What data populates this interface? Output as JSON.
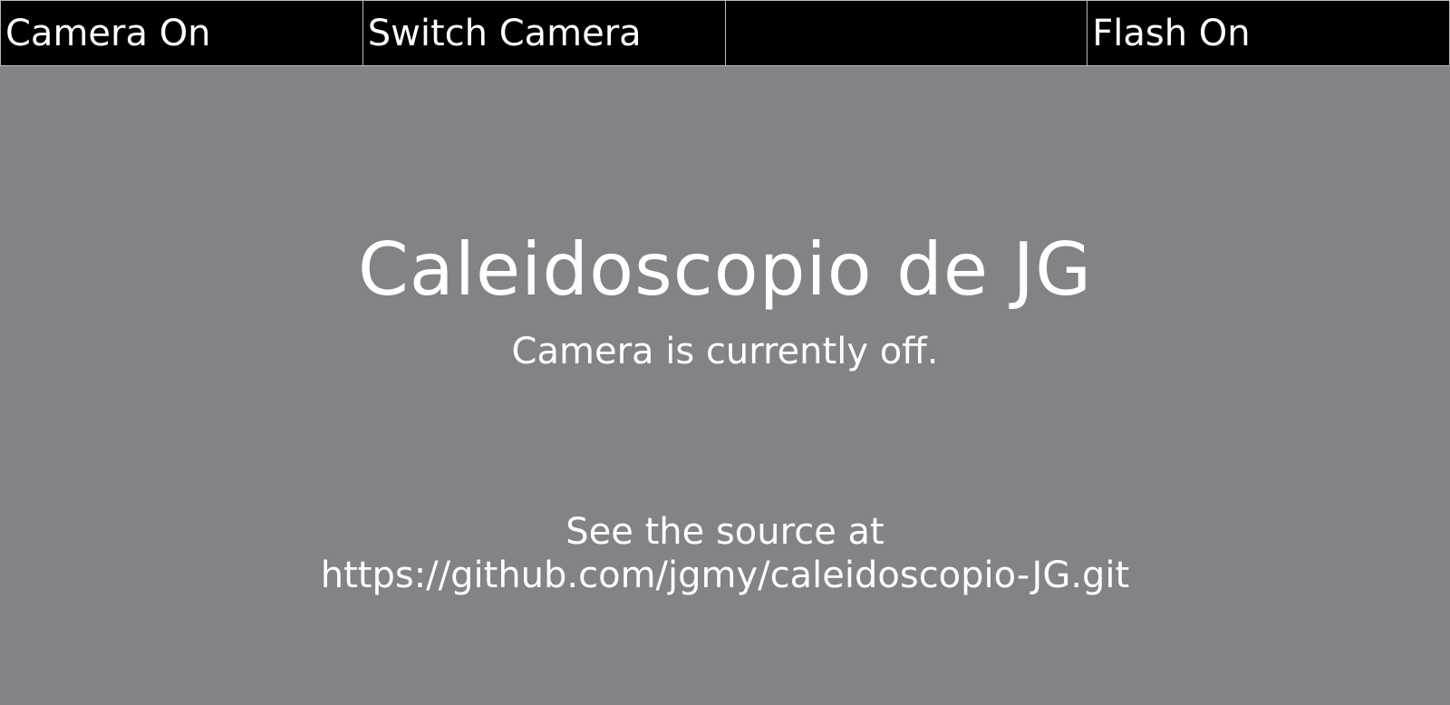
{
  "toolbar": {
    "buttons": [
      {
        "label": "Camera On"
      },
      {
        "label": "Switch Camera"
      },
      {
        "label": ""
      },
      {
        "label": "Flash On"
      }
    ]
  },
  "main": {
    "title": "Caleidoscopio de JG",
    "status": "Camera is currently off.",
    "source_line1": "See the source at",
    "source_line2": "https://github.com/jgmy/caleidoscopio-JG.git"
  },
  "colors": {
    "toolbar_bg": "#000000",
    "stage_bg": "#848286",
    "text": "#ffffff"
  }
}
